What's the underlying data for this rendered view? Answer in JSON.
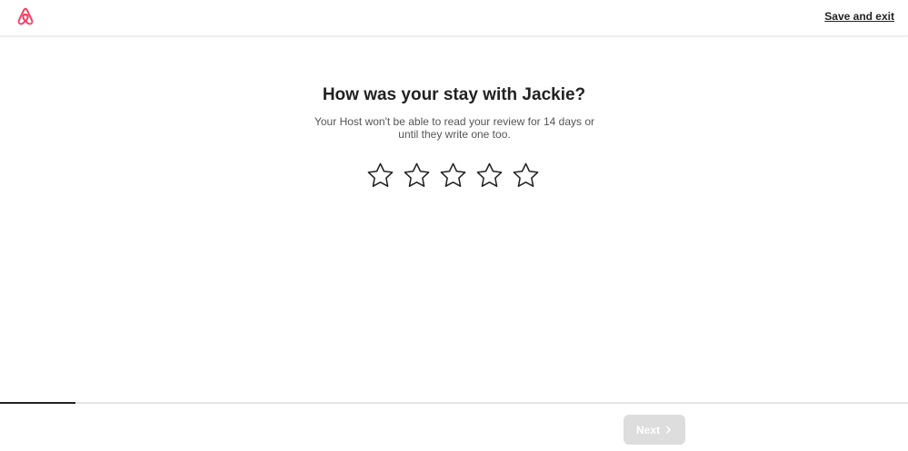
{
  "header": {
    "logo_icon": "airbnb-logo-icon",
    "brand_color": "#ff385c",
    "save_exit_label": "Save and exit"
  },
  "main": {
    "title": "How was your stay with Jackie?",
    "subtitle": "Your Host won't be able to read your review for 14 days or until they write one too.",
    "rating": {
      "max": 5,
      "selected": 0,
      "star_icon": "star-outline-icon"
    }
  },
  "footer": {
    "progress_fraction": 0.083,
    "next_label": "Next",
    "next_icon": "chevron-right-icon",
    "next_disabled": true
  }
}
